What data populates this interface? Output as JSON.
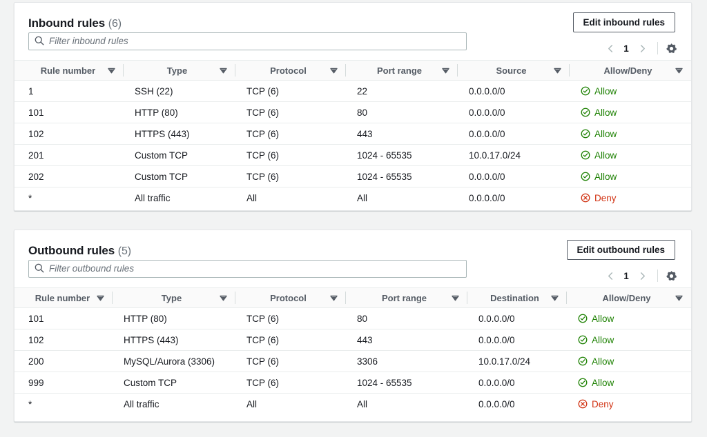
{
  "colors": {
    "allow": "#1d8102",
    "deny": "#d13212",
    "header_text": "#545b64",
    "page_bg": "#f2f3f3",
    "card_bg": "#ffffff"
  },
  "inbound": {
    "title": "Inbound rules",
    "count": "(6)",
    "edit_label": "Edit inbound rules",
    "filter_placeholder": "Filter inbound rules",
    "page_number": "1",
    "columns": [
      "Rule number",
      "Type",
      "Protocol",
      "Port range",
      "Source",
      "Allow/Deny"
    ],
    "rows": [
      {
        "rule_number": "1",
        "type": "SSH (22)",
        "protocol": "TCP (6)",
        "port_range": "22",
        "address": "0.0.0.0/0",
        "verdict": "Allow",
        "verdict_kind": "allow"
      },
      {
        "rule_number": "101",
        "type": "HTTP (80)",
        "protocol": "TCP (6)",
        "port_range": "80",
        "address": "0.0.0.0/0",
        "verdict": "Allow",
        "verdict_kind": "allow"
      },
      {
        "rule_number": "102",
        "type": "HTTPS (443)",
        "protocol": "TCP (6)",
        "port_range": "443",
        "address": "0.0.0.0/0",
        "verdict": "Allow",
        "verdict_kind": "allow"
      },
      {
        "rule_number": "201",
        "type": "Custom TCP",
        "protocol": "TCP (6)",
        "port_range": "1024 - 65535",
        "address": "10.0.17.0/24",
        "verdict": "Allow",
        "verdict_kind": "allow"
      },
      {
        "rule_number": "202",
        "type": "Custom TCP",
        "protocol": "TCP (6)",
        "port_range": "1024 - 65535",
        "address": "0.0.0.0/0",
        "verdict": "Allow",
        "verdict_kind": "allow"
      },
      {
        "rule_number": "*",
        "type": "All traffic",
        "protocol": "All",
        "port_range": "All",
        "address": "0.0.0.0/0",
        "verdict": "Deny",
        "verdict_kind": "deny"
      }
    ]
  },
  "outbound": {
    "title": "Outbound rules",
    "count": "(5)",
    "edit_label": "Edit outbound rules",
    "filter_placeholder": "Filter outbound rules",
    "page_number": "1",
    "columns": [
      "Rule number",
      "Type",
      "Protocol",
      "Port range",
      "Destination",
      "Allow/Deny"
    ],
    "rows": [
      {
        "rule_number": "101",
        "type": "HTTP (80)",
        "protocol": "TCP (6)",
        "port_range": "80",
        "address": "0.0.0.0/0",
        "verdict": "Allow",
        "verdict_kind": "allow"
      },
      {
        "rule_number": "102",
        "type": "HTTPS (443)",
        "protocol": "TCP (6)",
        "port_range": "443",
        "address": "0.0.0.0/0",
        "verdict": "Allow",
        "verdict_kind": "allow"
      },
      {
        "rule_number": "200",
        "type": "MySQL/Aurora (3306)",
        "protocol": "TCP (6)",
        "port_range": "3306",
        "address": "10.0.17.0/24",
        "verdict": "Allow",
        "verdict_kind": "allow"
      },
      {
        "rule_number": "999",
        "type": "Custom TCP",
        "protocol": "TCP (6)",
        "port_range": "1024 - 65535",
        "address": "0.0.0.0/0",
        "verdict": "Allow",
        "verdict_kind": "allow"
      },
      {
        "rule_number": "*",
        "type": "All traffic",
        "protocol": "All",
        "port_range": "All",
        "address": "0.0.0.0/0",
        "verdict": "Deny",
        "verdict_kind": "deny"
      }
    ]
  }
}
